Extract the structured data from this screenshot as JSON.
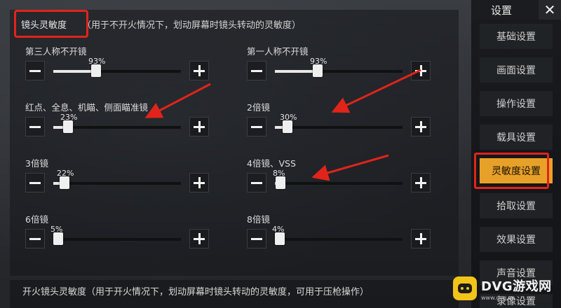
{
  "section": {
    "title": "镜头灵敏度",
    "description": "（用于不开火情况下，划动屏幕时镜头转动的灵敏度）"
  },
  "settings": [
    {
      "label": "第三人称不开镜",
      "value": "93%",
      "level": 0.32
    },
    {
      "label": "第一人称不开镜",
      "value": "93%",
      "level": 0.32
    },
    {
      "label": "红点、全息、机瞄、侧面瞄准镜",
      "value": "23%",
      "level": 0.1
    },
    {
      "label": "2倍镜",
      "value": "30%",
      "level": 0.08
    },
    {
      "label": "3倍镜",
      "value": "22%",
      "level": 0.07
    },
    {
      "label": "4倍镜、VSS",
      "value": "8%",
      "level": 0.03
    },
    {
      "label": "6倍镜",
      "value": "5%",
      "level": 0.02
    },
    {
      "label": "8倍镜",
      "value": "4%",
      "level": 0.02
    }
  ],
  "bottom": {
    "text": "开火镜头灵敏度（用于开火情况下，划动屏幕时镜头转动的灵敏度，可用于压枪操作）"
  },
  "sidebar": {
    "title": "设置",
    "items": [
      {
        "label": "基础设置"
      },
      {
        "label": "画面设置"
      },
      {
        "label": "操作设置"
      },
      {
        "label": "载具设置"
      },
      {
        "label": "灵敏度设置"
      },
      {
        "label": "拾取设置"
      },
      {
        "label": "效果设置"
      },
      {
        "label": "声音设置"
      },
      {
        "label": "录像设置"
      }
    ],
    "active_index": 4
  },
  "watermark": {
    "name": "DVG游戏网",
    "url": "www.dvg.cn"
  },
  "colors": {
    "accent": "#e8a128",
    "highlight": "#e0241b"
  }
}
